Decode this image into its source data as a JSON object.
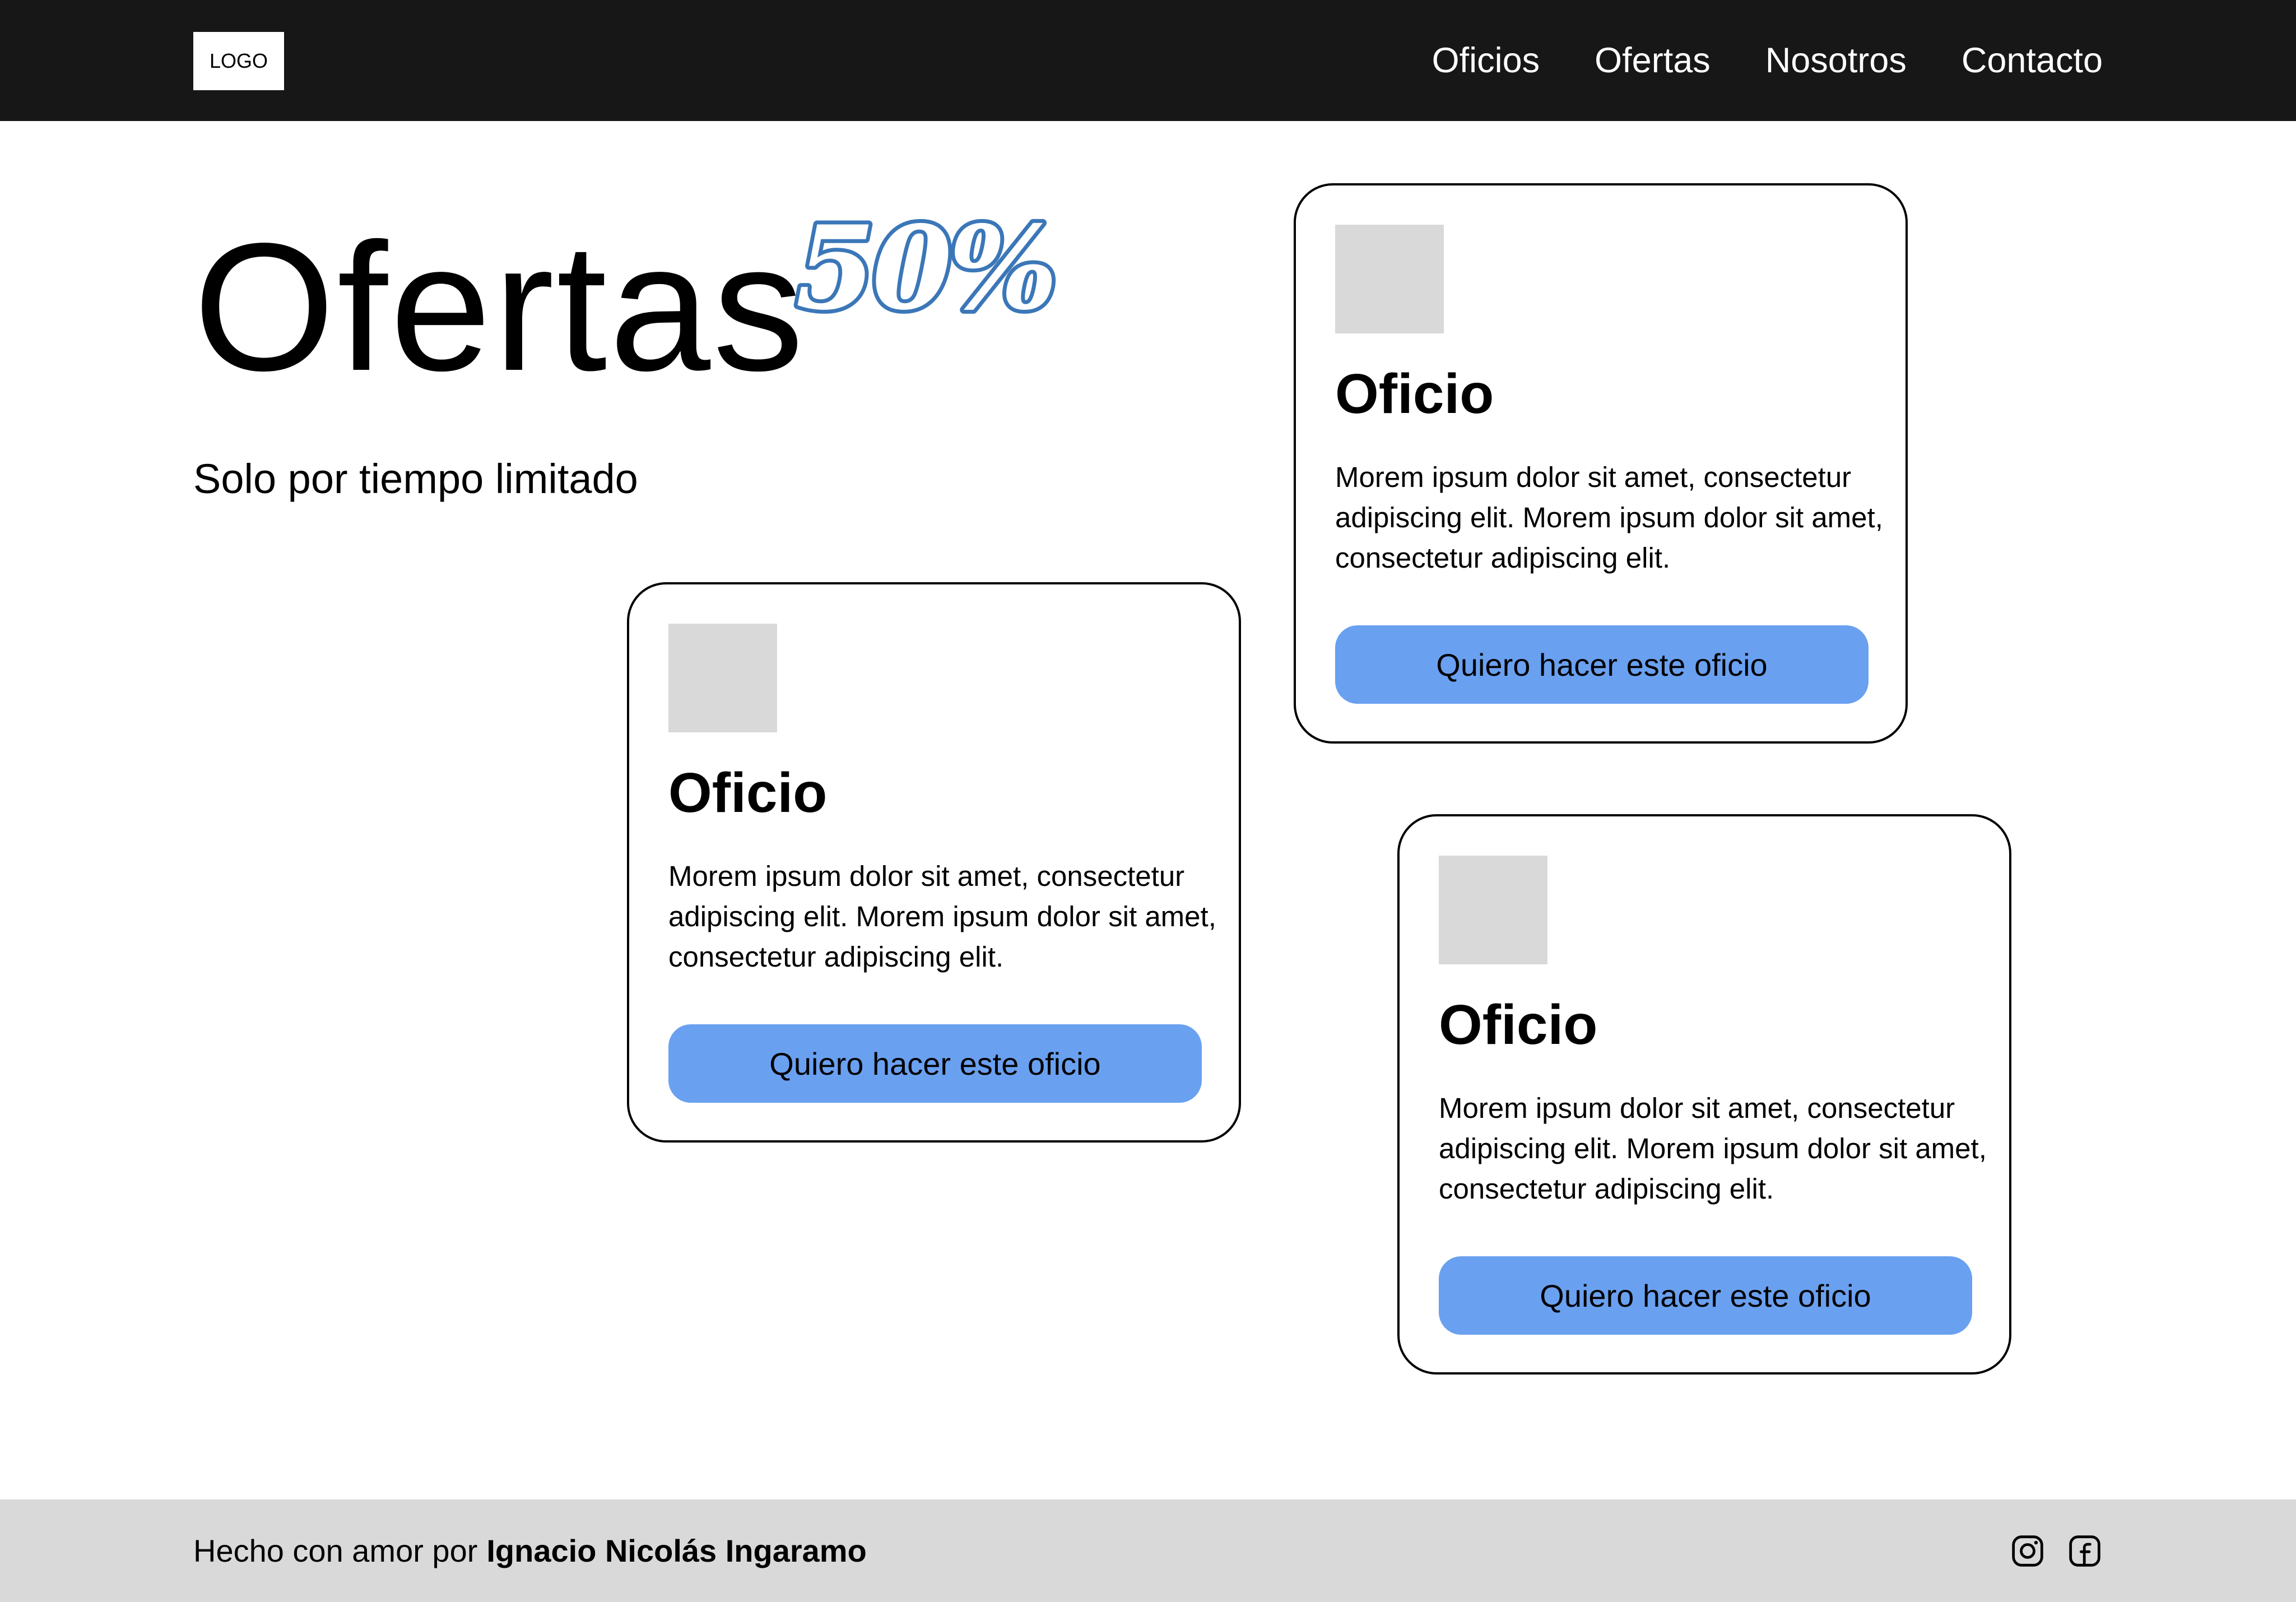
{
  "nav": {
    "logo": "LOGO",
    "links": [
      "Oficios",
      "Ofertas",
      "Nosotros",
      "Contacto"
    ]
  },
  "hero": {
    "title": "Ofertas",
    "badge": "50%",
    "subtitle": "Solo por tiempo limitado"
  },
  "cards": [
    {
      "title": "Oficio",
      "text": "Morem ipsum dolor sit amet, consectetur adipiscing elit. Morem ipsum dolor sit amet, consectetur adipiscing elit.",
      "button": "Quiero hacer este oficio"
    },
    {
      "title": "Oficio",
      "text": "Morem ipsum dolor sit amet, consectetur adipiscing elit. Morem ipsum dolor sit amet, consectetur adipiscing elit.",
      "button": "Quiero hacer este oficio"
    },
    {
      "title": "Oficio",
      "text": "Morem ipsum dolor sit amet, consectetur adipiscing elit. Morem ipsum dolor sit amet, consectetur adipiscing elit.",
      "button": "Quiero hacer este oficio"
    }
  ],
  "footer": {
    "prefix": "Hecho con amor por",
    "author": "Ignacio Nicolás Ingaramo",
    "social_icons": [
      "instagram-icon",
      "facebook-icon"
    ]
  },
  "colors": {
    "nav_bg": "#171717",
    "accent_button": "#6aa0f0",
    "badge": "#3b77b8",
    "placeholder": "#d9d9d9",
    "footer_bg": "#d9d9d9"
  }
}
